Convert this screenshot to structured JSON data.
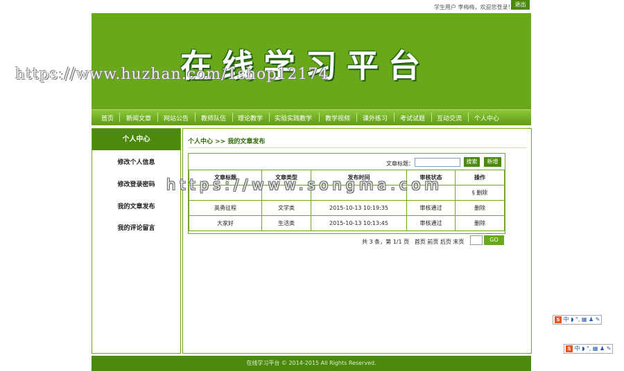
{
  "topbar": {
    "welcome": "学生用户 李梅梅，欢迎您登录！",
    "logout": "退出"
  },
  "banner": {
    "title": "在线学习平台"
  },
  "watermarks": {
    "w1": "https://www.huzhan.com/1shop12174",
    "w2": "https://www.songma.com"
  },
  "nav": {
    "items": [
      "首页",
      "新闻文章",
      "网站公告",
      "教师队伍",
      "理论教学",
      "实验实践教学",
      "教学视频",
      "课外练习",
      "考试试题",
      "互动交流",
      "个人中心"
    ]
  },
  "sidebar": {
    "title": "个人中心",
    "links": [
      "修改个人信息",
      "修改登录密码",
      "我的文章发布",
      "我的评论留言"
    ]
  },
  "breadcrumb": "个人中心 >> 我的文章发布",
  "search": {
    "label": "文章标题：",
    "value": "",
    "search_button": "搜索",
    "add_button": "新增"
  },
  "table": {
    "headers": [
      "文章标题",
      "文章类型",
      "发布时间",
      "审核状态",
      "操作"
    ],
    "rows": [
      {
        "title": "",
        "type": "",
        "time": "",
        "status": "",
        "action": "删除",
        "action_icon": "§"
      },
      {
        "title": "英勇征程",
        "type": "文学类",
        "time": "2015-10-13 10:19:35",
        "status": "审核通过",
        "action": "删除"
      },
      {
        "title": "大家好",
        "type": "生活类",
        "time": "2015-10-13 10:13:45",
        "status": "审核通过",
        "action": "删除"
      }
    ]
  },
  "pager": {
    "summary": "共 3 条，第 1/1 页",
    "first": "首页",
    "prev": "前页",
    "next": "后页",
    "last": "末页",
    "go": "GO"
  },
  "footer": "在线学习平台 © 2014-2015 All Rights Reserved.",
  "ime": {
    "text": "中 ◗ °, ▦ ♟ ✎"
  }
}
